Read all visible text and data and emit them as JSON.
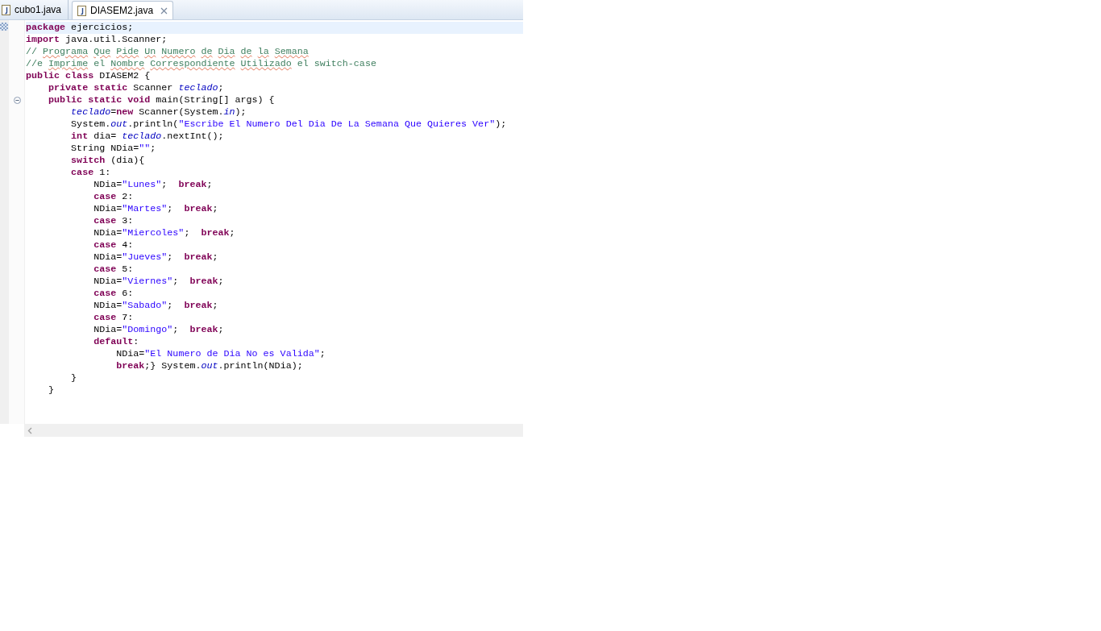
{
  "tabs": [
    {
      "label": "cubo1.java",
      "selected": false,
      "closable": false
    },
    {
      "label": "DIASEM2.java",
      "selected": true,
      "closable": true
    }
  ],
  "editor": {
    "lines": [
      {
        "kind": "plain",
        "current": true,
        "tokens": [
          {
            "kind": "keyword",
            "text": "package"
          },
          {
            "kind": "text",
            "text": " ejercicios;"
          }
        ]
      },
      {
        "kind": "plain",
        "current": false,
        "tokens": [
          {
            "kind": "keyword",
            "text": "import"
          },
          {
            "kind": "text",
            "text": " java.util.Scanner;"
          }
        ]
      },
      {
        "kind": "plain",
        "current": false,
        "tokens": [
          {
            "kind": "comment",
            "text": "//"
          },
          {
            "kind": "misspelled",
            "text": " Programa"
          },
          {
            "kind": "misspelled",
            "text": " Que"
          },
          {
            "kind": "misspelled",
            "text": " Pide"
          },
          {
            "kind": "misspelled",
            "text": " Un"
          },
          {
            "kind": "misspelled",
            "text": " Numero"
          },
          {
            "kind": "misspelled",
            "text": " de"
          },
          {
            "kind": "misspelled",
            "text": " Dia"
          },
          {
            "kind": "misspelled",
            "text": " de"
          },
          {
            "kind": "misspelled",
            "text": " la"
          },
          {
            "kind": "misspelled",
            "text": " Semana"
          }
        ]
      },
      {
        "kind": "plain",
        "current": false,
        "tokens": [
          {
            "kind": "comment",
            "text": "//e"
          },
          {
            "kind": "misspelled",
            "text": " Imprime"
          },
          {
            "kind": "comment",
            "text": " el"
          },
          {
            "kind": "misspelled",
            "text": " Nombre"
          },
          {
            "kind": "misspelled",
            "text": " Correspondiente"
          },
          {
            "kind": "misspelled",
            "text": " Utilizado"
          },
          {
            "kind": "comment",
            "text": " el switch-case"
          }
        ]
      },
      {
        "kind": "plain",
        "current": false,
        "tokens": [
          {
            "kind": "keyword",
            "text": "public class"
          },
          {
            "kind": "text",
            "text": " DIASEM2 {"
          }
        ]
      },
      {
        "kind": "plain",
        "current": false,
        "tokens": [
          {
            "kind": "keyword",
            "text": "    private static"
          },
          {
            "kind": "text",
            "text": " Scanner "
          },
          {
            "kind": "field",
            "text": "teclado"
          },
          {
            "kind": "text",
            "text": ";"
          }
        ]
      },
      {
        "kind": "fold-start",
        "current": false,
        "tokens": [
          {
            "kind": "keyword",
            "text": "    public static void"
          },
          {
            "kind": "text",
            "text": " main(String[] args) {"
          }
        ]
      },
      {
        "kind": "plain",
        "current": false,
        "tokens": [
          {
            "kind": "field",
            "text": "        teclado"
          },
          {
            "kind": "text",
            "text": "="
          },
          {
            "kind": "keyword",
            "text": "new"
          },
          {
            "kind": "text",
            "text": " Scanner(System."
          },
          {
            "kind": "field",
            "text": "in"
          },
          {
            "kind": "text",
            "text": ");"
          }
        ]
      },
      {
        "kind": "plain",
        "current": false,
        "tokens": [
          {
            "kind": "text",
            "text": "        System."
          },
          {
            "kind": "field",
            "text": "out"
          },
          {
            "kind": "text",
            "text": ".println("
          },
          {
            "kind": "string",
            "text": "\"Escribe El Numero Del Dia De La Semana Que Quieres Ver\""
          },
          {
            "kind": "text",
            "text": ");"
          }
        ]
      },
      {
        "kind": "plain",
        "current": false,
        "tokens": [
          {
            "kind": "keyword",
            "text": "        int"
          },
          {
            "kind": "text",
            "text": " dia= "
          },
          {
            "kind": "field",
            "text": "teclado"
          },
          {
            "kind": "text",
            "text": ".nextInt();"
          }
        ]
      },
      {
        "kind": "plain",
        "current": false,
        "tokens": [
          {
            "kind": "text",
            "text": "        String NDia="
          },
          {
            "kind": "string",
            "text": "\"\""
          },
          {
            "kind": "text",
            "text": ";"
          }
        ]
      },
      {
        "kind": "plain",
        "current": false,
        "tokens": [
          {
            "kind": "keyword",
            "text": "        switch"
          },
          {
            "kind": "text",
            "text": " (dia){"
          }
        ]
      },
      {
        "kind": "plain",
        "current": false,
        "tokens": [
          {
            "kind": "keyword",
            "text": "        case"
          },
          {
            "kind": "text",
            "text": " 1:"
          }
        ]
      },
      {
        "kind": "plain",
        "current": false,
        "tokens": [
          {
            "kind": "text",
            "text": "            NDia="
          },
          {
            "kind": "string",
            "text": "\"Lunes\""
          },
          {
            "kind": "text",
            "text": ";  "
          },
          {
            "kind": "keyword",
            "text": "break"
          },
          {
            "kind": "text",
            "text": ";"
          }
        ]
      },
      {
        "kind": "plain",
        "current": false,
        "tokens": [
          {
            "kind": "keyword",
            "text": "            case"
          },
          {
            "kind": "text",
            "text": " 2:"
          }
        ]
      },
      {
        "kind": "plain",
        "current": false,
        "tokens": [
          {
            "kind": "text",
            "text": "            NDia="
          },
          {
            "kind": "string",
            "text": "\"Martes\""
          },
          {
            "kind": "text",
            "text": ";  "
          },
          {
            "kind": "keyword",
            "text": "break"
          },
          {
            "kind": "text",
            "text": ";"
          }
        ]
      },
      {
        "kind": "plain",
        "current": false,
        "tokens": [
          {
            "kind": "keyword",
            "text": "            case"
          },
          {
            "kind": "text",
            "text": " 3:"
          }
        ]
      },
      {
        "kind": "plain",
        "current": false,
        "tokens": [
          {
            "kind": "text",
            "text": "            NDia="
          },
          {
            "kind": "string",
            "text": "\"Miercoles\""
          },
          {
            "kind": "text",
            "text": ";  "
          },
          {
            "kind": "keyword",
            "text": "break"
          },
          {
            "kind": "text",
            "text": ";"
          }
        ]
      },
      {
        "kind": "plain",
        "current": false,
        "tokens": [
          {
            "kind": "keyword",
            "text": "            case"
          },
          {
            "kind": "text",
            "text": " 4:"
          }
        ]
      },
      {
        "kind": "plain",
        "current": false,
        "tokens": [
          {
            "kind": "text",
            "text": "            NDia="
          },
          {
            "kind": "string",
            "text": "\"Jueves\""
          },
          {
            "kind": "text",
            "text": ";  "
          },
          {
            "kind": "keyword",
            "text": "break"
          },
          {
            "kind": "text",
            "text": ";"
          }
        ]
      },
      {
        "kind": "plain",
        "current": false,
        "tokens": [
          {
            "kind": "keyword",
            "text": "            case"
          },
          {
            "kind": "text",
            "text": " 5:"
          }
        ]
      },
      {
        "kind": "plain",
        "current": false,
        "tokens": [
          {
            "kind": "text",
            "text": "            NDia="
          },
          {
            "kind": "string",
            "text": "\"Viernes\""
          },
          {
            "kind": "text",
            "text": ";  "
          },
          {
            "kind": "keyword",
            "text": "break"
          },
          {
            "kind": "text",
            "text": ";"
          }
        ]
      },
      {
        "kind": "plain",
        "current": false,
        "tokens": [
          {
            "kind": "keyword",
            "text": "            case"
          },
          {
            "kind": "text",
            "text": " 6:"
          }
        ]
      },
      {
        "kind": "plain",
        "current": false,
        "tokens": [
          {
            "kind": "text",
            "text": "            NDia="
          },
          {
            "kind": "string",
            "text": "\"Sabado\""
          },
          {
            "kind": "text",
            "text": ";  "
          },
          {
            "kind": "keyword",
            "text": "break"
          },
          {
            "kind": "text",
            "text": ";"
          }
        ]
      },
      {
        "kind": "plain",
        "current": false,
        "tokens": [
          {
            "kind": "keyword",
            "text": "            case"
          },
          {
            "kind": "text",
            "text": " 7:"
          }
        ]
      },
      {
        "kind": "plain",
        "current": false,
        "tokens": [
          {
            "kind": "text",
            "text": "            NDia="
          },
          {
            "kind": "string",
            "text": "\"Domingo\""
          },
          {
            "kind": "text",
            "text": ";  "
          },
          {
            "kind": "keyword",
            "text": "break"
          },
          {
            "kind": "text",
            "text": ";"
          }
        ]
      },
      {
        "kind": "plain",
        "current": false,
        "tokens": [
          {
            "kind": "keyword",
            "text": "            default"
          },
          {
            "kind": "text",
            "text": ":"
          }
        ]
      },
      {
        "kind": "plain",
        "current": false,
        "tokens": [
          {
            "kind": "text",
            "text": "                NDia="
          },
          {
            "kind": "string",
            "text": "\"El Numero de Dia No es Valida\""
          },
          {
            "kind": "text",
            "text": ";"
          }
        ]
      },
      {
        "kind": "plain",
        "current": false,
        "tokens": [
          {
            "kind": "keyword",
            "text": "                break"
          },
          {
            "kind": "text",
            "text": ";} System."
          },
          {
            "kind": "field",
            "text": "out"
          },
          {
            "kind": "text",
            "text": ".println(NDia);"
          }
        ]
      },
      {
        "kind": "plain",
        "current": false,
        "tokens": [
          {
            "kind": "text",
            "text": "        }"
          }
        ]
      },
      {
        "kind": "plain",
        "current": false,
        "tokens": [
          {
            "kind": "text",
            "text": "    }"
          }
        ]
      }
    ]
  }
}
